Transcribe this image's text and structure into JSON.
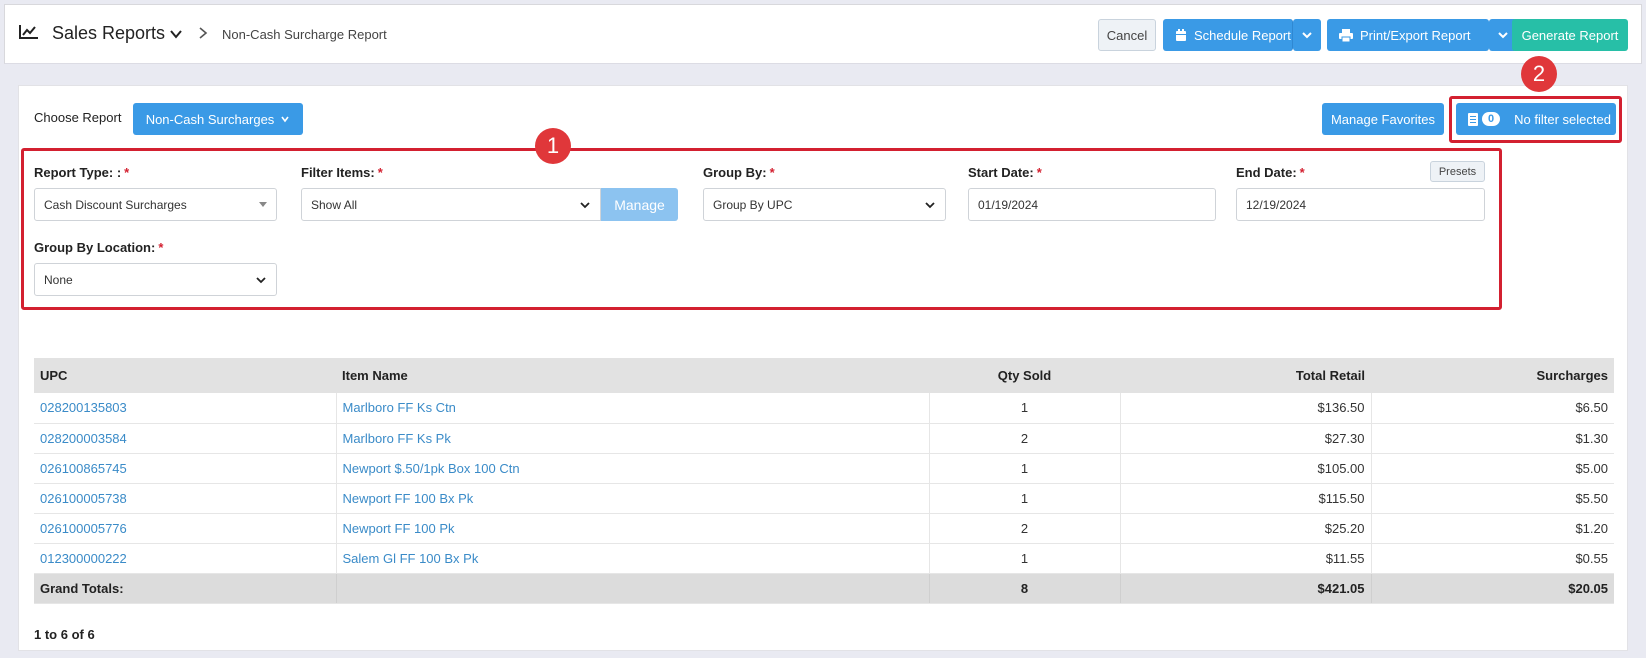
{
  "header": {
    "title": "Sales Reports",
    "breadcrumb": "Non-Cash Surcharge Report",
    "cancel_label": "Cancel",
    "schedule_label": "Schedule Report",
    "print_label": "Print/Export Report",
    "generate_label": "Generate Report"
  },
  "toolbar": {
    "choose_label": "Choose Report",
    "choose_value": "Non-Cash Surcharges",
    "favorites_label": "Manage Favorites",
    "filter_count": "0",
    "filter_label": "No filter selected"
  },
  "callouts": {
    "one": "1",
    "two": "2"
  },
  "filters": {
    "report_type": {
      "label": "Report Type: :",
      "value": "Cash Discount Surcharges"
    },
    "filter_items": {
      "label": "Filter Items:",
      "value": "Show All",
      "manage_label": "Manage"
    },
    "group_by": {
      "label": "Group By:",
      "value": "Group By UPC"
    },
    "start_date": {
      "label": "Start Date:",
      "value": "01/19/2024"
    },
    "end_date": {
      "label": "End Date:",
      "value": "12/19/2024",
      "presets_label": "Presets"
    },
    "group_by_location": {
      "label": "Group By Location:",
      "value": "None"
    },
    "required_mark": "*"
  },
  "table": {
    "headers": [
      "UPC",
      "Item Name",
      "Qty Sold",
      "Total Retail",
      "Surcharges"
    ],
    "rows": [
      [
        "028200135803",
        "Marlboro FF Ks Ctn",
        "1",
        "$136.50",
        "$6.50"
      ],
      [
        "028200003584",
        "Marlboro FF Ks Pk",
        "2",
        "$27.30",
        "$1.30"
      ],
      [
        "026100865745",
        "Newport $.50/1pk Box 100 Ctn",
        "1",
        "$105.00",
        "$5.00"
      ],
      [
        "026100005738",
        "Newport FF 100 Bx Pk",
        "1",
        "$115.50",
        "$5.50"
      ],
      [
        "026100005776",
        "Newport FF 100 Pk",
        "2",
        "$25.20",
        "$1.20"
      ],
      [
        "012300000222",
        "Salem Gl FF 100 Bx Pk",
        "1",
        "$11.55",
        "$0.55"
      ]
    ],
    "totals": [
      "Grand Totals:",
      "",
      "8",
      "$421.05",
      "$20.05"
    ]
  },
  "pager": "1 to 6 of 6",
  "colors": {
    "primary": "#3a9ae6",
    "generate": "#27bfa7",
    "highlight": "#d32030",
    "link": "#3a8bc8"
  }
}
